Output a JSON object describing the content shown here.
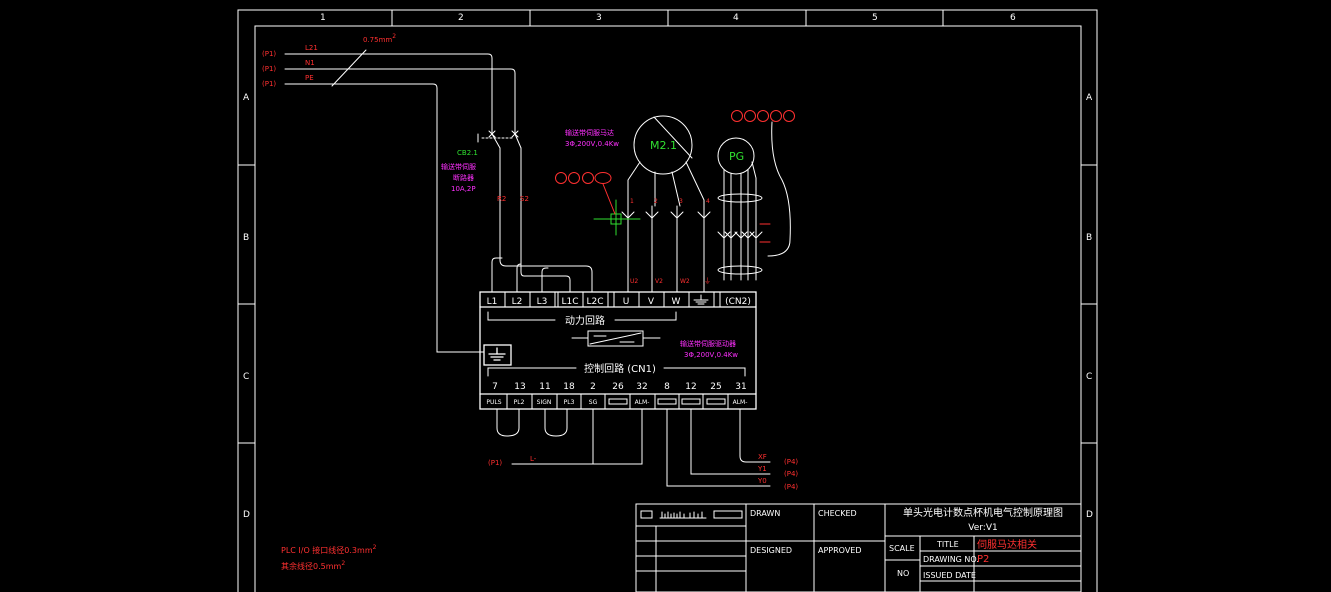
{
  "frame": {
    "col_numbers": [
      "1",
      "2",
      "3",
      "4",
      "5",
      "6"
    ],
    "row_letters": [
      "A",
      "B",
      "C",
      "D"
    ]
  },
  "supply": {
    "refs": [
      "(P1)",
      "(P1)",
      "(P1)"
    ],
    "lines": [
      "L21",
      "N1",
      "PE"
    ],
    "wire_size": "0.75mm",
    "wire_size_sup": "2"
  },
  "breaker": {
    "tag": "CB2.1",
    "name": "输送带伺服",
    "name2": "断路器",
    "rating": "10A,2P",
    "out_labels": [
      "R2",
      "S2"
    ]
  },
  "motor": {
    "tag": "M2.1",
    "name": "输送带伺服马达",
    "spec": "3Φ,200V,0.4Kw",
    "terminals": [
      "1",
      "2",
      "3",
      "4"
    ],
    "phase_labels": [
      "U2",
      "V2",
      "W2",
      "⏚"
    ]
  },
  "encoder": {
    "tag": "PG"
  },
  "driver": {
    "power_terminals": [
      "L1",
      "L2",
      "L3",
      "L1C",
      "L2C",
      "U",
      "V",
      "W",
      "",
      "(CN2)"
    ],
    "power_title": "动力回路",
    "name": "输送带伺服驱动器",
    "spec": "3Φ,200V,0.4Kw",
    "control_title": "控制回路 (CN1)",
    "pin_numbers": [
      "7",
      "13",
      "11",
      "18",
      "2",
      "26",
      "32",
      "8",
      "12",
      "25",
      "31"
    ],
    "pin_names": [
      "PULS",
      "PL2",
      "SIGN",
      "PL3",
      "SG",
      "",
      "ALM-",
      "",
      "",
      "",
      "ALM-"
    ]
  },
  "io": {
    "left_ref": "(P1)",
    "left_label": "L-",
    "right_labels": [
      "XF",
      "Y1",
      "Y0"
    ],
    "right_refs": [
      "(P4)",
      "(P4)",
      "(P4)"
    ]
  },
  "notes": {
    "line1": "PLC I/O 接口线径0.3mm",
    "line2": "其余线径0.5mm",
    "sup": "2"
  },
  "title_block": {
    "drawn": "DRAWN",
    "checked": "CHECKED",
    "designed": "DESIGNED",
    "approved": "APPROVED",
    "project": "单头光电计数点杯机电气控制原理图",
    "version": "Ver:V1",
    "scale": "SCALE",
    "no": "NO",
    "title_label": "TITLE",
    "title_value": "伺服马达相关",
    "drawing_no_label": "DRAWING NO.",
    "drawing_no_value": "P2",
    "issued": "ISSUED DATE"
  }
}
